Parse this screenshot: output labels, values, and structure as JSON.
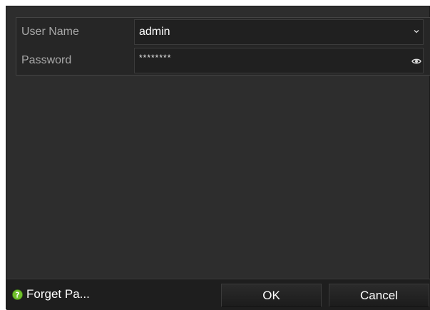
{
  "login": {
    "username": {
      "label": "User Name",
      "value": "admin",
      "icon": "chevron-down-icon"
    },
    "password": {
      "label": "Password",
      "value": "********",
      "icon": "eye-icon"
    }
  },
  "footer": {
    "forget_label": "Forget Pa...",
    "forget_icon": "question-icon",
    "ok_label": "OK",
    "cancel_label": "Cancel"
  },
  "colors": {
    "panel": "#2d2d2d",
    "field": "#202020",
    "label_text": "#a8a8a8",
    "value_text": "#ffffff",
    "help_icon": "#6fbf2a"
  }
}
